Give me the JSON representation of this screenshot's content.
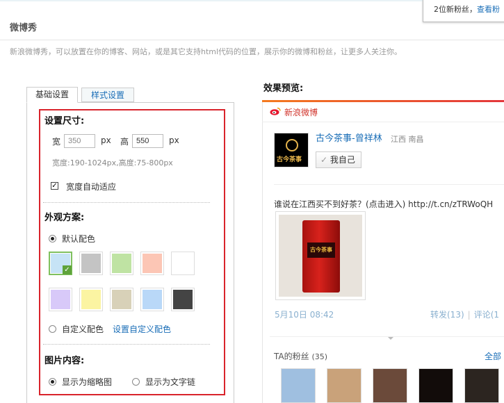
{
  "notification": {
    "text": "2位新粉丝，",
    "link": "查看粉"
  },
  "page": {
    "title": "微博秀",
    "description": "新浪微博秀，可以放置在你的博客、网站，或是其它支持html代码的位置，展示你的微博和粉丝，让更多人关注你。"
  },
  "tabs": [
    {
      "label": "基础设置",
      "active": true
    },
    {
      "label": "样式设置",
      "active": false
    }
  ],
  "settings": {
    "size": {
      "title": "设置尺寸:",
      "width_label": "宽",
      "width_value": "350",
      "height_label": "高",
      "height_value": "550",
      "unit": "px",
      "range_hint": "宽度:190-1024px,高度:75-800px",
      "auto_width_label": "宽度自动适应",
      "auto_width_checked": true
    },
    "appearance": {
      "title": "外观方案:",
      "default_label": "默认配色",
      "default_selected": true,
      "custom_label": "自定义配色",
      "custom_link": "设置自定义配色",
      "swatches": [
        {
          "color": "#c6e3f6",
          "selected": true
        },
        {
          "color": "#c4c4c4",
          "selected": false
        },
        {
          "color": "#bfe3a3",
          "selected": false
        },
        {
          "color": "#fcc6b5",
          "selected": false
        },
        {
          "color": "#ffffff",
          "selected": false
        },
        {
          "color": "#d8c9f9",
          "selected": false
        },
        {
          "color": "#fbf4a2",
          "selected": false
        },
        {
          "color": "#d8d1b8",
          "selected": false
        },
        {
          "color": "#b9d8f8",
          "selected": false
        },
        {
          "color": "#444444",
          "selected": false
        }
      ]
    },
    "image_content": {
      "title": "图片内容:",
      "option_thumb": "显示为缩略图",
      "option_text": "显示为文字链",
      "selected": "thumb"
    }
  },
  "preview": {
    "title": "效果预览:",
    "brand": "新浪微博",
    "user_name": "古今茶事-曾祥林",
    "location": "江西 南昌",
    "avatar_text": "古今茶事",
    "self_button": "我自己",
    "post_text": "谁说在江西买不到好茶？(点击进入) http://t.cn/zTRWoQH",
    "post_time": "5月10日 08:42",
    "repost": "转发(13)",
    "comment": "评论(1",
    "fans_label": "TA的粉丝",
    "fans_count": "(35)",
    "fans_all": "全部",
    "fan_colors": [
      "#9fbfe0",
      "#c9a27a",
      "#6b4a3a",
      "#120c0a",
      "#2c2520"
    ]
  }
}
